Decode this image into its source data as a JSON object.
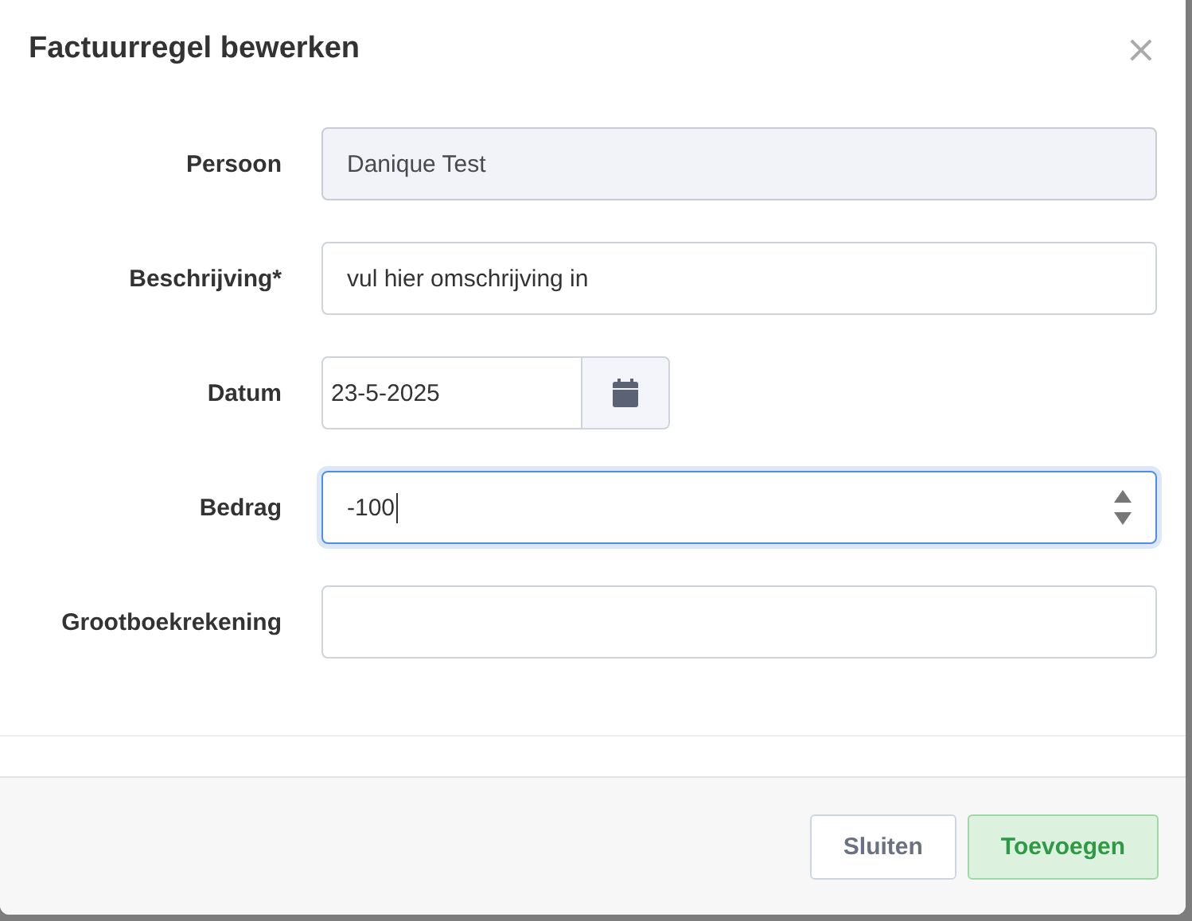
{
  "dialog": {
    "title": "Factuurregel bewerken",
    "close": "×"
  },
  "fields": [
    {
      "label": "Persoon",
      "kind": "text",
      "value": "Danique Test",
      "disabled": true,
      "focused": false
    },
    {
      "label": "Beschrijving*",
      "kind": "text",
      "value": "vul hier omschrijving in",
      "disabled": false,
      "focused": false
    },
    {
      "label": "Datum",
      "kind": "date",
      "value": "23-5-2025",
      "disabled": false,
      "focused": false
    },
    {
      "label": "Bedrag",
      "kind": "number",
      "value": "-100",
      "disabled": false,
      "focused": true
    },
    {
      "label": "Grootboekrekening",
      "kind": "text",
      "disabled": false,
      "focused": false
    }
  ],
  "buttons": [
    {
      "label": "Sluiten",
      "kind": "secondary"
    },
    {
      "label": "Toevoegen",
      "kind": "primary"
    }
  ]
}
